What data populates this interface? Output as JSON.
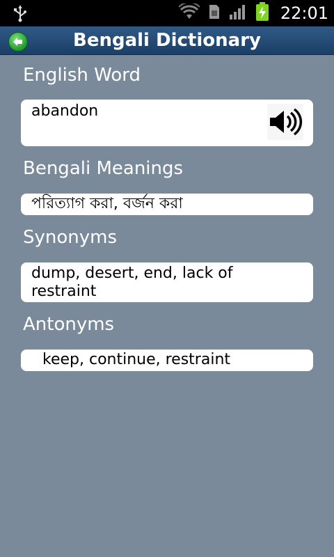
{
  "status_bar": {
    "time": "22:01",
    "icons": [
      "usb-icon",
      "wifi-icon",
      "sim-icon",
      "signal-icon",
      "battery-charging-icon"
    ]
  },
  "title_bar": {
    "title": "Bengali Dictionary",
    "back_icon": "back-arrow-icon"
  },
  "sections": {
    "english_word": {
      "label": "English Word",
      "value": "abandon",
      "speaker_icon": "speaker-icon"
    },
    "bengali_meanings": {
      "label": "Bengali Meanings",
      "value": "পরিত্যাগ করা, বর্জন করা"
    },
    "synonyms": {
      "label": "Synonyms",
      "value": "dump, desert, end, lack of restraint"
    },
    "antonyms": {
      "label": "Antonyms",
      "value": "keep, continue, restraint"
    }
  },
  "colors": {
    "background": "#7a8a9a",
    "title_bar": "#1f4670",
    "status_bar": "#000000",
    "battery": "#7fd321"
  }
}
